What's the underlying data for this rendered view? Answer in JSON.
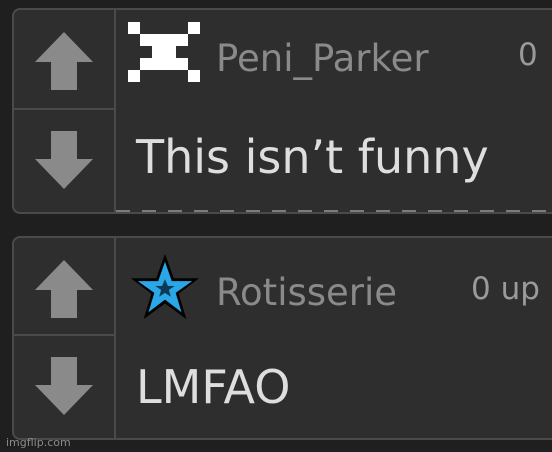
{
  "colors": {
    "background": "#1f1f1f",
    "card": "#2e2e2e",
    "border": "#4a4a4a",
    "arrow": "#8a8a8a",
    "username": "#8a8a8a",
    "body_text": "#dedede",
    "star": "#2aa7e6"
  },
  "comments": [
    {
      "username": "Peni_Parker",
      "points": "0",
      "body": "This isn’t funny",
      "icon": "pixel-skull-icon",
      "upvote_icon": "arrow-up-icon",
      "downvote_icon": "arrow-down-icon"
    },
    {
      "username": "Rotisserie",
      "points": "0 up",
      "body": "LMFAO",
      "icon": "blue-star-icon",
      "upvote_icon": "arrow-up-icon",
      "downvote_icon": "arrow-down-icon"
    }
  ],
  "watermark": "imgflip.com"
}
